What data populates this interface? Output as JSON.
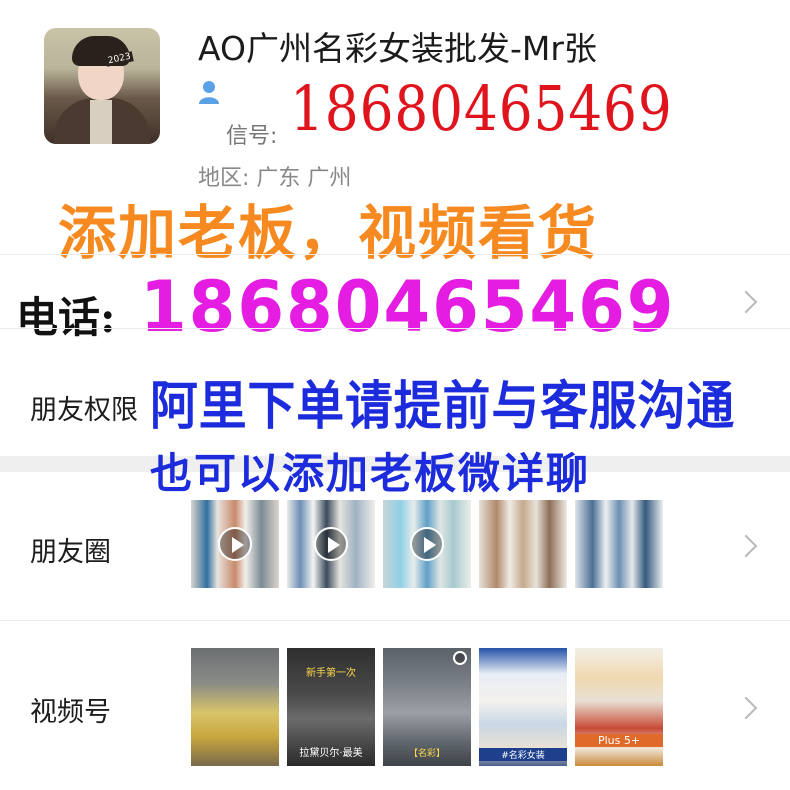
{
  "profile": {
    "nickname": "AO广州名彩女装批发-Mr张",
    "avatar_tag": "2023",
    "wechat_label": "信号:",
    "wechat_number": "18680465469",
    "region": "地区: 广东 广州",
    "person_icon": "person-icon"
  },
  "promo": {
    "line1": "添加老板，视频看货",
    "phone_label": "电话:",
    "phone_number": "18680465469",
    "line2": "阿里下单请提前与客服沟通",
    "line3": "也可以添加老板微详聊"
  },
  "rows": {
    "friend_permissions": "朋友权限",
    "moments": "朋友圈",
    "channels": "视频号"
  },
  "channel_captions": {
    "c2_top": "新手第一次",
    "c2_bottom": "拉黛贝尔·最美",
    "c3_bottom": "【名彩】",
    "c4_bottom": "#名彩女装",
    "c5_bottom": "Plus 5+"
  },
  "colors": {
    "wechat_number": "#e0141c",
    "promo_orange": "#f6891f",
    "phone_magenta": "#e51ce2",
    "promo_blue": "#1c2bdb"
  },
  "icons": [
    "person-icon",
    "chevron-right-icon",
    "play-icon",
    "search-icon"
  ]
}
